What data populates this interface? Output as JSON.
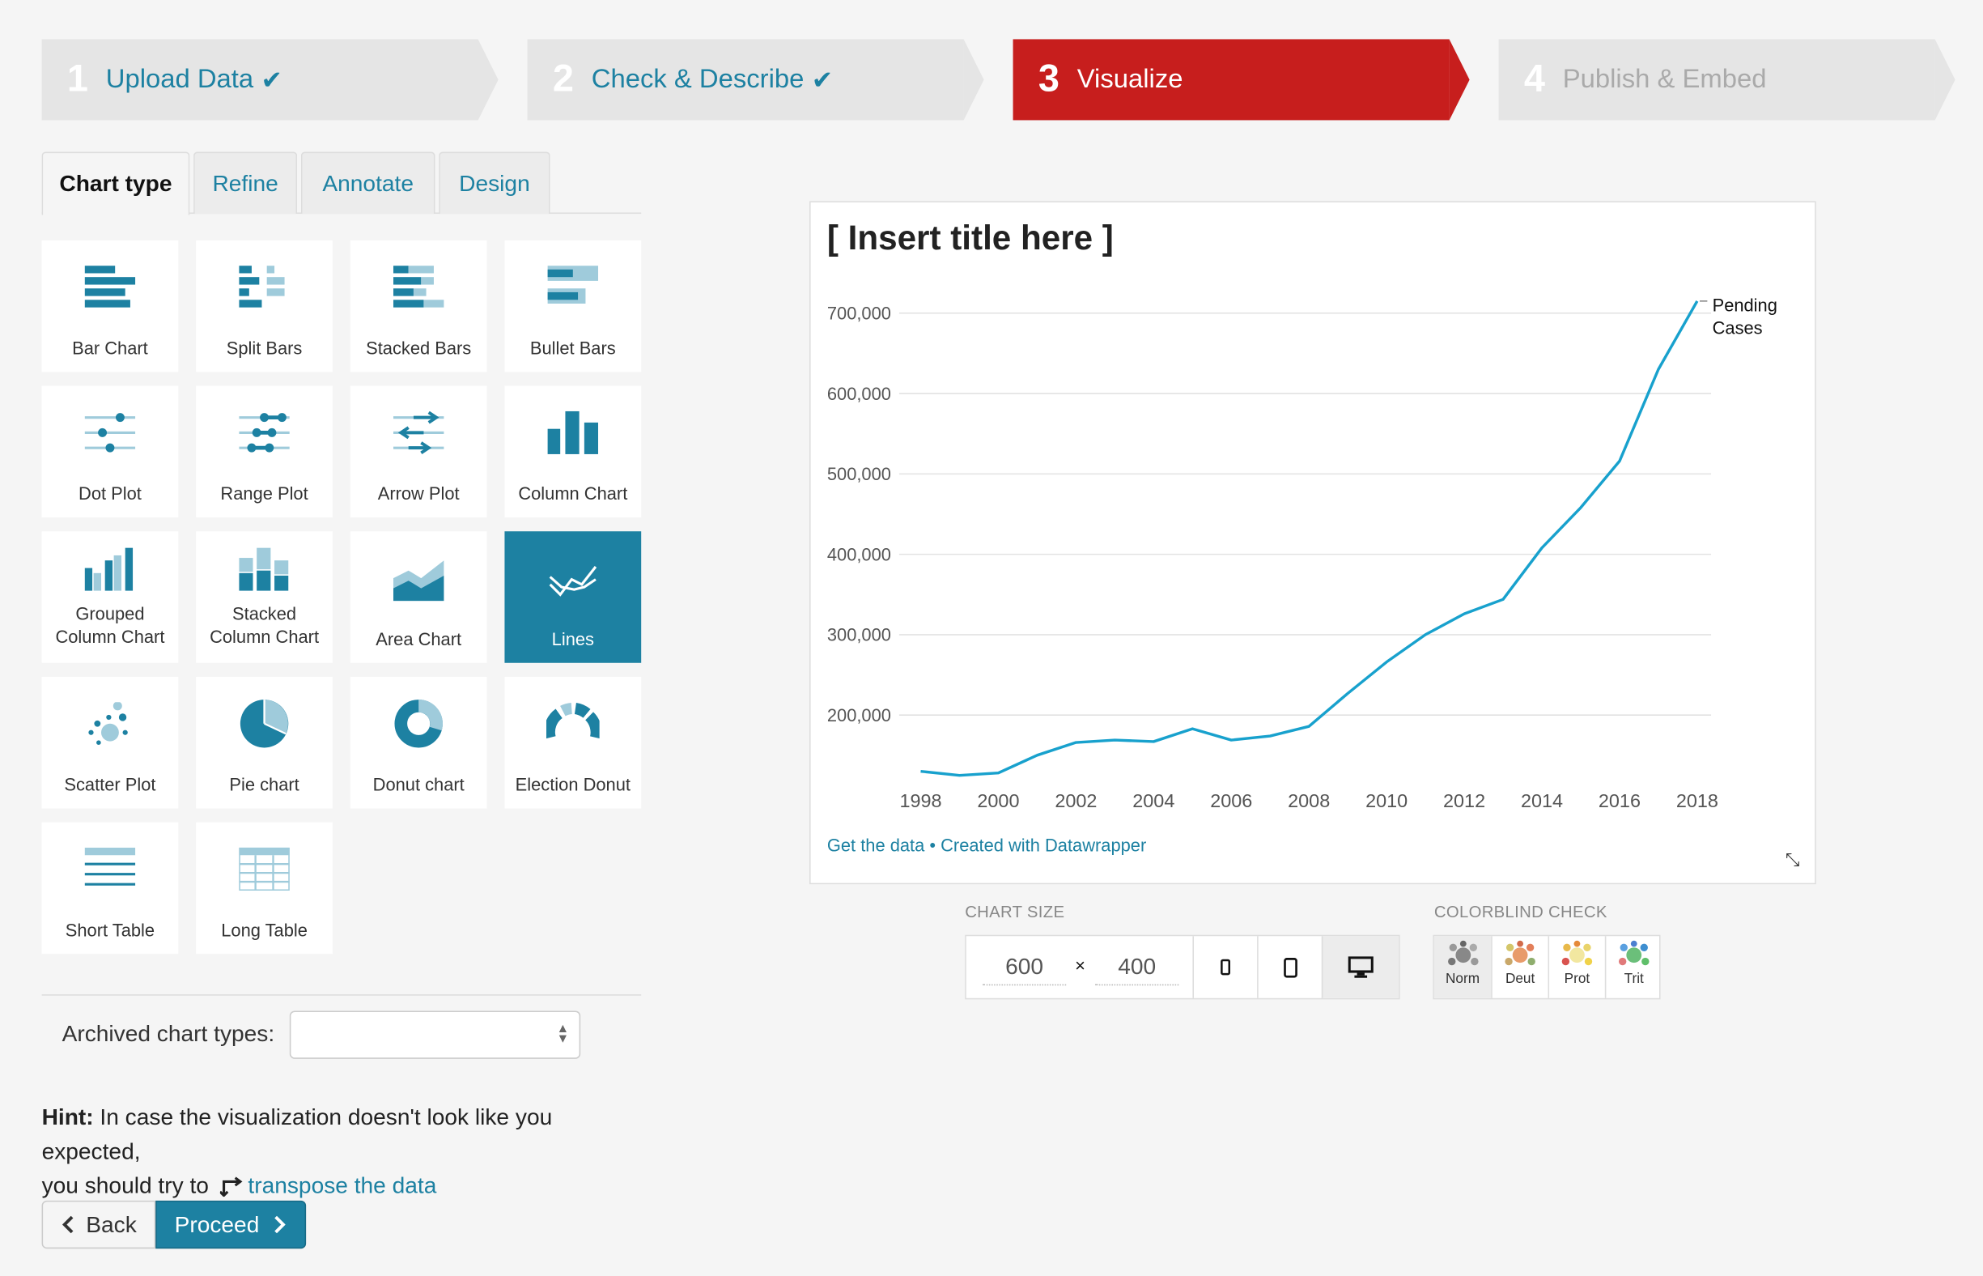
{
  "steps": [
    {
      "num": "1",
      "label": "Upload Data",
      "done": true,
      "state": "done"
    },
    {
      "num": "2",
      "label": "Check & Describe",
      "done": true,
      "state": "done"
    },
    {
      "num": "3",
      "label": "Visualize",
      "done": false,
      "state": "active"
    },
    {
      "num": "4",
      "label": "Publish & Embed",
      "done": false,
      "state": "disabled"
    }
  ],
  "tabs": [
    "Chart type",
    "Refine",
    "Annotate",
    "Design"
  ],
  "chart_types": [
    {
      "label": "Bar Chart",
      "icon": "bar-chart-icon"
    },
    {
      "label": "Split Bars",
      "icon": "split-bars-icon"
    },
    {
      "label": "Stacked Bars",
      "icon": "stacked-bars-icon"
    },
    {
      "label": "Bullet Bars",
      "icon": "bullet-bars-icon"
    },
    {
      "label": "Dot Plot",
      "icon": "dot-plot-icon"
    },
    {
      "label": "Range Plot",
      "icon": "range-plot-icon"
    },
    {
      "label": "Arrow Plot",
      "icon": "arrow-plot-icon"
    },
    {
      "label": "Column Chart",
      "icon": "column-chart-icon"
    },
    {
      "label": "Grouped Column Chart",
      "label_lines": [
        "Grouped",
        "Column Chart"
      ],
      "icon": "grouped-column-chart-icon"
    },
    {
      "label": "Stacked Column Chart",
      "label_lines": [
        "Stacked",
        "Column Chart"
      ],
      "icon": "stacked-column-chart-icon"
    },
    {
      "label": "Area Chart",
      "icon": "area-chart-icon"
    },
    {
      "label": "Lines",
      "icon": "lines-icon",
      "selected": true
    },
    {
      "label": "Scatter Plot",
      "icon": "scatter-plot-icon"
    },
    {
      "label": "Pie chart",
      "icon": "pie-chart-icon"
    },
    {
      "label": "Donut chart",
      "icon": "donut-chart-icon"
    },
    {
      "label": "Election Donut",
      "icon": "election-donut-icon"
    },
    {
      "label": "Short Table",
      "icon": "short-table-icon"
    },
    {
      "label": "Long Table",
      "icon": "long-table-icon"
    }
  ],
  "archived": {
    "label": "Archived chart types:",
    "value": ""
  },
  "hint": {
    "bold": "Hint:",
    "text1": " In case the visualization doesn't look like you expected,",
    "text2": "you should try to",
    "link": "transpose the data"
  },
  "buttons": {
    "back": "Back",
    "proceed": "Proceed"
  },
  "preview": {
    "footer_link1": "Get the data",
    "footer_sep": " • ",
    "footer_link2": "Created with Datawrapper"
  },
  "chart_size": {
    "label": "CHART SIZE",
    "width": "600",
    "height": "400",
    "times": "×"
  },
  "colorblind": {
    "label": "COLORBLIND CHECK",
    "modes": [
      "Norm",
      "Deut",
      "Prot",
      "Trit"
    ]
  },
  "colors": {
    "accent": "#1d81a2",
    "active_step": "#c71e1d",
    "line": "#18a1cd"
  },
  "chart_data": {
    "type": "line",
    "title": "[ Insert title here ]",
    "xlabel": "",
    "ylabel": "",
    "x": [
      1998,
      1999,
      2000,
      2001,
      2002,
      2003,
      2004,
      2005,
      2006,
      2007,
      2008,
      2009,
      2010,
      2011,
      2012,
      2013,
      2014,
      2015,
      2016,
      2017,
      2018
    ],
    "x_ticks": [
      "1998",
      "2000",
      "2002",
      "2004",
      "2006",
      "2008",
      "2010",
      "2012",
      "2014",
      "2016",
      "2018"
    ],
    "y_ticks": [
      "200,000",
      "300,000",
      "400,000",
      "500,000",
      "600,000",
      "700,000"
    ],
    "ylim": [
      117000,
      715000
    ],
    "grid": true,
    "series": [
      {
        "name": "Pending Cases",
        "name_lines": [
          "Pending",
          "Cases"
        ],
        "values": [
          130000,
          125000,
          128000,
          150000,
          166000,
          169000,
          167000,
          183000,
          169000,
          174000,
          186000,
          227000,
          266000,
          300000,
          326000,
          344000,
          408000,
          458000,
          516000,
          630000,
          715000
        ]
      }
    ]
  }
}
